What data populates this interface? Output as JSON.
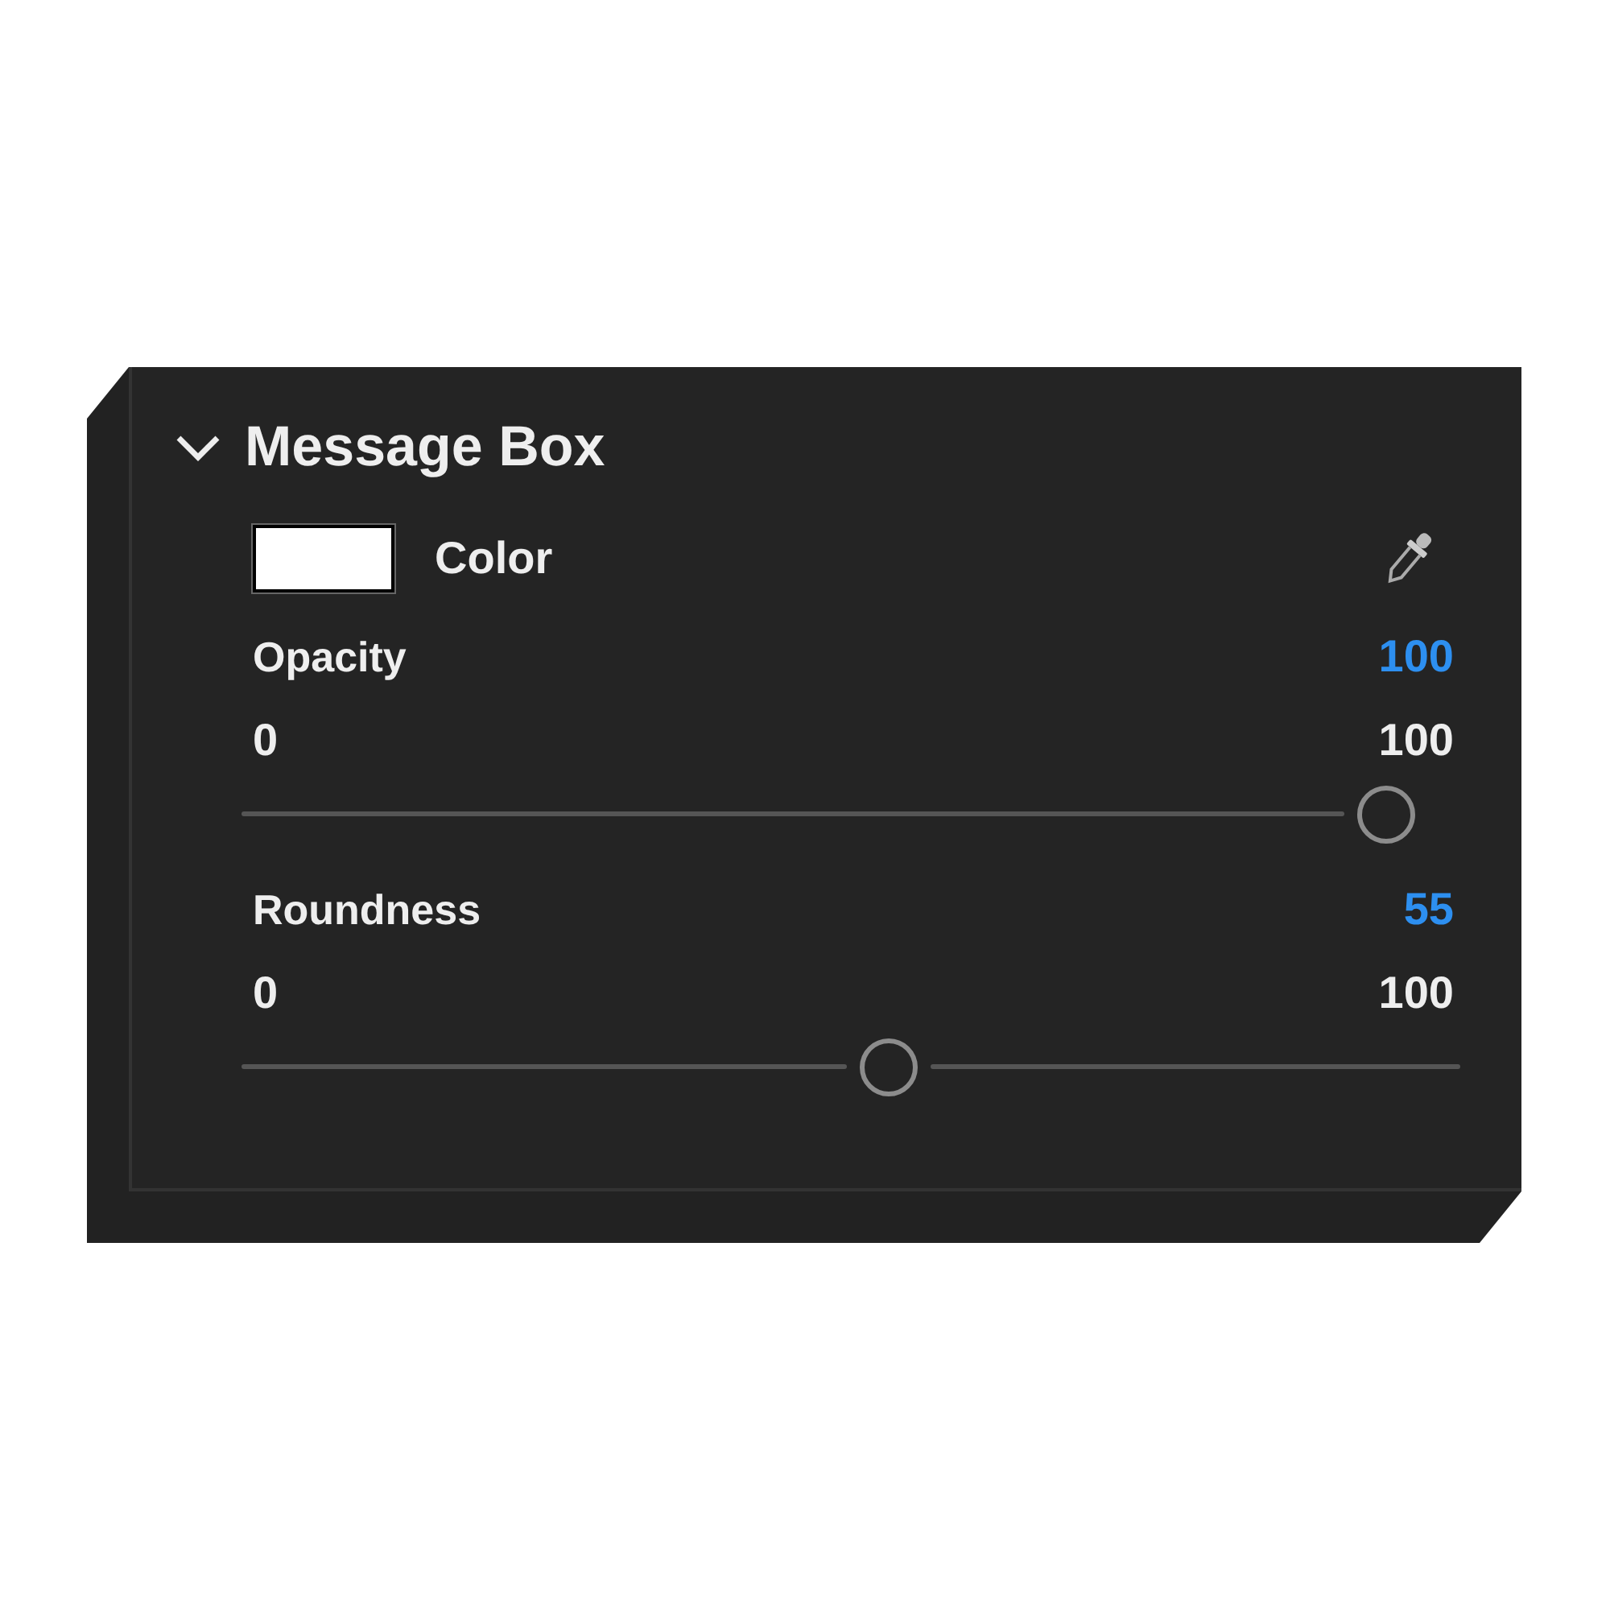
{
  "section": {
    "title": "Message Box",
    "expanded": true
  },
  "color_row": {
    "label": "Color",
    "color": "#ffffff"
  },
  "sliders": [
    {
      "label": "Opacity",
      "value": "100",
      "min": "0",
      "max": "100",
      "level": 1.0
    },
    {
      "label": "Roundness",
      "value": "55",
      "min": "0",
      "max": "100",
      "level": 0.55
    }
  ]
}
